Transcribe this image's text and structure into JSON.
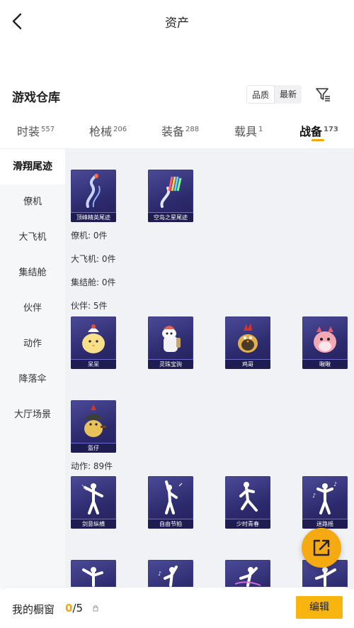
{
  "header": {
    "title": "资产"
  },
  "warehouse": {
    "title": "游戏仓库",
    "sort": {
      "quality": "品质",
      "latest": "最新"
    }
  },
  "tabs": [
    {
      "label": "时装",
      "count": "557"
    },
    {
      "label": "枪械",
      "count": "206"
    },
    {
      "label": "装备",
      "count": "288"
    },
    {
      "label": "载具",
      "count": "1"
    },
    {
      "label": "战备",
      "count": "173"
    }
  ],
  "sidebar": {
    "items": [
      "滑翔尾迹",
      "僚机",
      "大飞机",
      "集结舱",
      "伙伴",
      "动作",
      "降落伞",
      "大厅场景"
    ]
  },
  "content": {
    "glide_trails": [
      "顶峰精英尾迹",
      "空岛之星尾迹"
    ],
    "wingman_count": "僚机: 0件",
    "plane_count": "大飞机: 0件",
    "pod_count": "集结舱: 0件",
    "partner_count": "伙伴: 5件",
    "partners": [
      "呆呆",
      "灵珠宝驹",
      "鸡哥",
      "啾啾",
      "盔仔"
    ],
    "emote_count": "动作: 89件",
    "emotes": [
      "剑意纵横",
      "自由节拍",
      "少时青春",
      "迷路摇"
    ]
  },
  "bottom": {
    "showcase_label": "我的橱窗",
    "showcase_current": "0",
    "showcase_total": "/5",
    "edit_label": "编辑"
  },
  "colors": {
    "accent": "#f5a800",
    "card_bg": "#2c2a6c"
  }
}
